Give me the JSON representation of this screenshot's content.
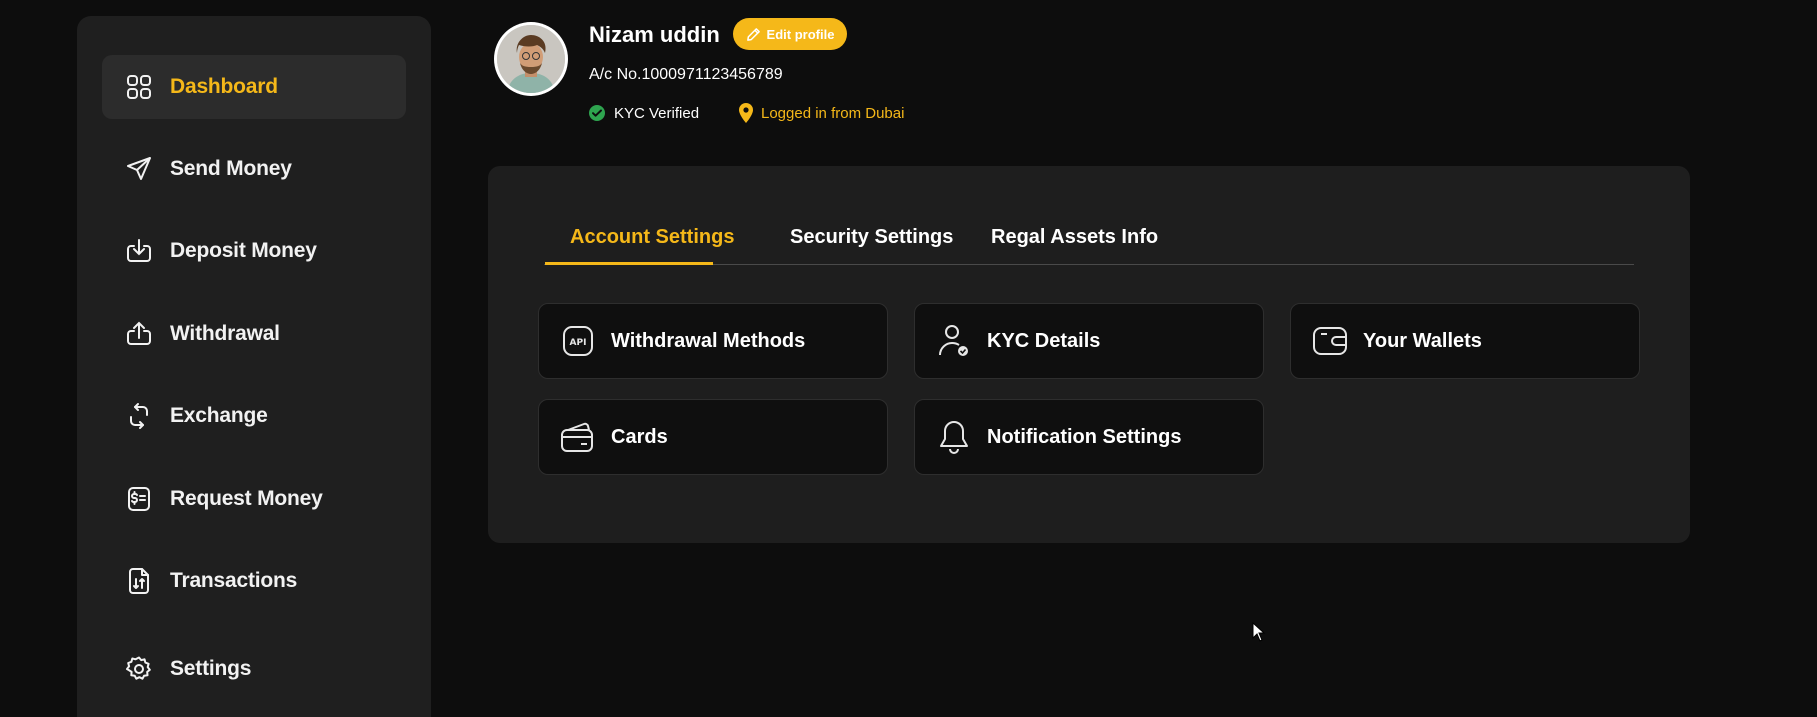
{
  "colors": {
    "accent": "#f5b819",
    "verified": "#2ea44f"
  },
  "sidebar": {
    "items": [
      {
        "label": "Dashboard",
        "icon": "grid-icon",
        "active": true
      },
      {
        "label": "Send Money",
        "icon": "send-icon"
      },
      {
        "label": "Deposit Money",
        "icon": "download-icon"
      },
      {
        "label": "Withdrawal",
        "icon": "upload-icon"
      },
      {
        "label": "Exchange",
        "icon": "exchange-icon"
      },
      {
        "label": "Request Money",
        "icon": "invoice-dollar-icon"
      },
      {
        "label": "Transactions",
        "icon": "document-transfer-icon"
      },
      {
        "label": "Settings",
        "icon": "gear-icon"
      }
    ]
  },
  "profile": {
    "name": "Nizam uddin",
    "edit_label": "Edit profile",
    "account_number": "A/c No.1000971123456789",
    "kyc_status": "KYC Verified",
    "location": "Logged in from Dubai"
  },
  "settings": {
    "tabs": [
      {
        "label": "Account Settings",
        "active": true
      },
      {
        "label": "Security Settings"
      },
      {
        "label": "Regal Assets Info"
      }
    ],
    "cards": [
      {
        "label": "Withdrawal Methods",
        "icon": "api-icon"
      },
      {
        "label": "KYC Details",
        "icon": "user-check-icon"
      },
      {
        "label": "Your Wallets",
        "icon": "wallet-icon"
      },
      {
        "label": "Cards",
        "icon": "cards-icon"
      },
      {
        "label": "Notification Settings",
        "icon": "bell-icon"
      }
    ]
  }
}
